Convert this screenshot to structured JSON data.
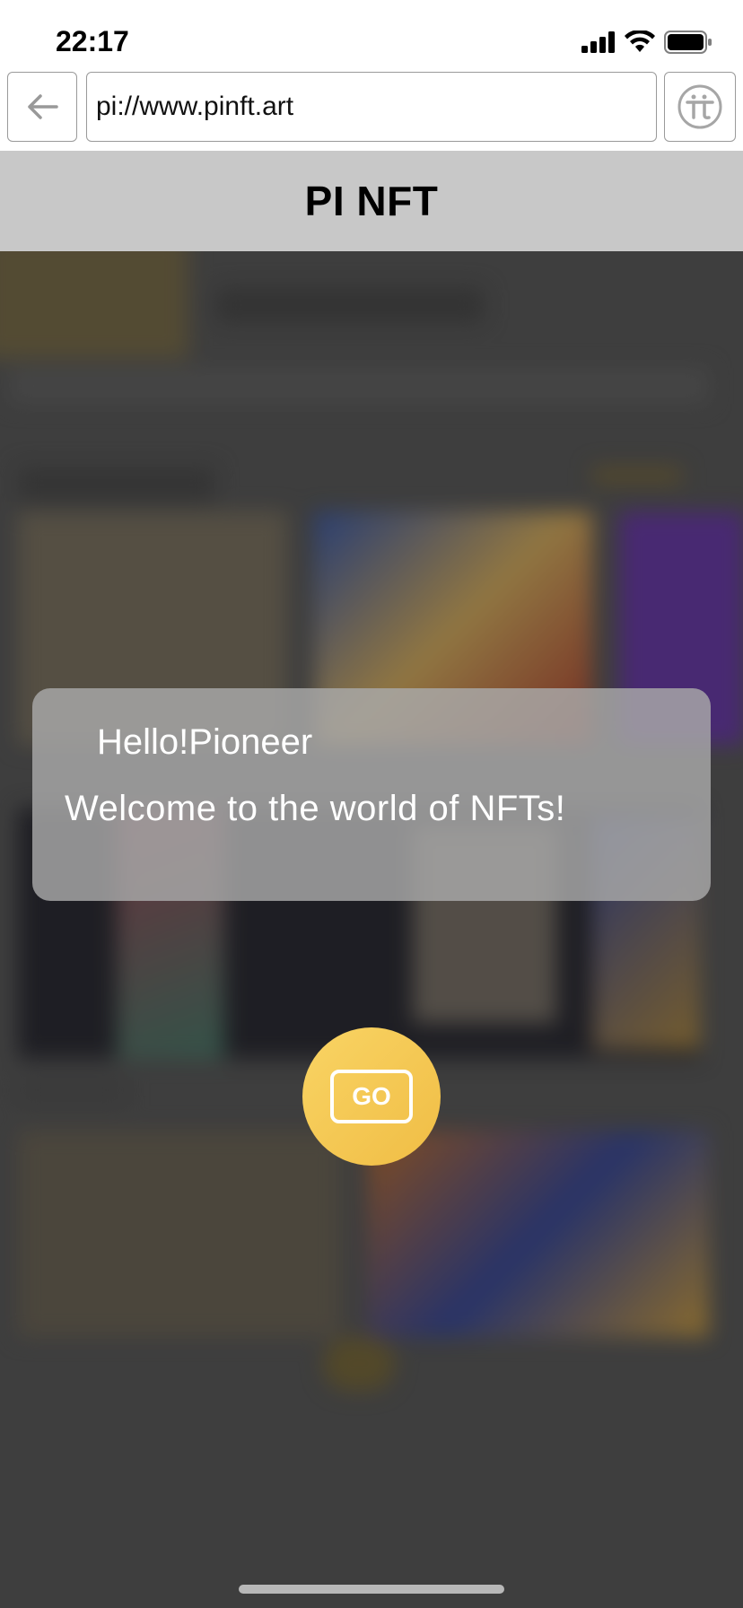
{
  "status_bar": {
    "time": "22:17"
  },
  "browser": {
    "url": "pi://www.pinft.art"
  },
  "header": {
    "title": "PI NFT"
  },
  "welcome": {
    "greeting": "Hello!Pioneer",
    "message": "Welcome to the world of NFTs!"
  },
  "go_button": {
    "label": "GO"
  },
  "colors": {
    "title_bar_bg": "#c8c8c8",
    "go_button": "#f5c955",
    "overlay_card": "#aaaaaa"
  },
  "icons": {
    "back": "arrow-left-icon",
    "pi": "pi-logo-icon",
    "signal": "cellular-signal-icon",
    "wifi": "wifi-icon",
    "battery": "battery-icon"
  }
}
